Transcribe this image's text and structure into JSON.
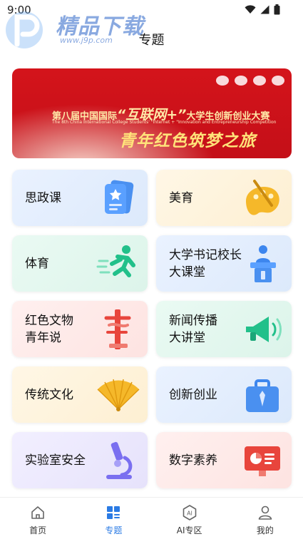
{
  "status": {
    "time": "9:00"
  },
  "watermark": {
    "title": "精品下载",
    "url": "www.j9p.com"
  },
  "header": {
    "title": "专题"
  },
  "banner": {
    "line1_prefix": "第八届中国国际",
    "line1_big": "“互联网+”",
    "line1_suffix": "大学生创新创业大赛",
    "line2": "The 8th China International College Students' \"Internet + \"Innovation and Entrepreneurship Competition",
    "line3": "青年红色筑梦之旅"
  },
  "cards": [
    {
      "line1": "思政课",
      "line2": "",
      "icon": "book-star-icon"
    },
    {
      "line1": "美育",
      "line2": "",
      "icon": "palette-icon"
    },
    {
      "line1": "体育",
      "line2": "",
      "icon": "runner-icon"
    },
    {
      "line1": "大学书记校长",
      "line2": "大课堂",
      "icon": "podium-icon"
    },
    {
      "line1": "红色文物",
      "line2": "青年说",
      "icon": "red-relic-icon"
    },
    {
      "line1": "新闻传播",
      "line2": "大讲堂",
      "icon": "megaphone-icon"
    },
    {
      "line1": "传统文化",
      "line2": "",
      "icon": "fan-icon"
    },
    {
      "line1": "创新创业",
      "line2": "",
      "icon": "briefcase-icon"
    },
    {
      "line1": "实验室安全",
      "line2": "",
      "icon": "microscope-icon"
    },
    {
      "line1": "数字素养",
      "line2": "",
      "icon": "screen-chart-icon"
    }
  ],
  "tabbar": {
    "items": [
      {
        "label": "首页",
        "icon": "home-icon",
        "active": false
      },
      {
        "label": "专题",
        "icon": "grid-list-icon",
        "active": true
      },
      {
        "label": "AI专区",
        "icon": "ai-icon",
        "active": false
      },
      {
        "label": "我的",
        "icon": "user-icon",
        "active": false
      }
    ]
  },
  "colors": {
    "accent": "#2b7be4",
    "banner_red": "#c8101a"
  }
}
